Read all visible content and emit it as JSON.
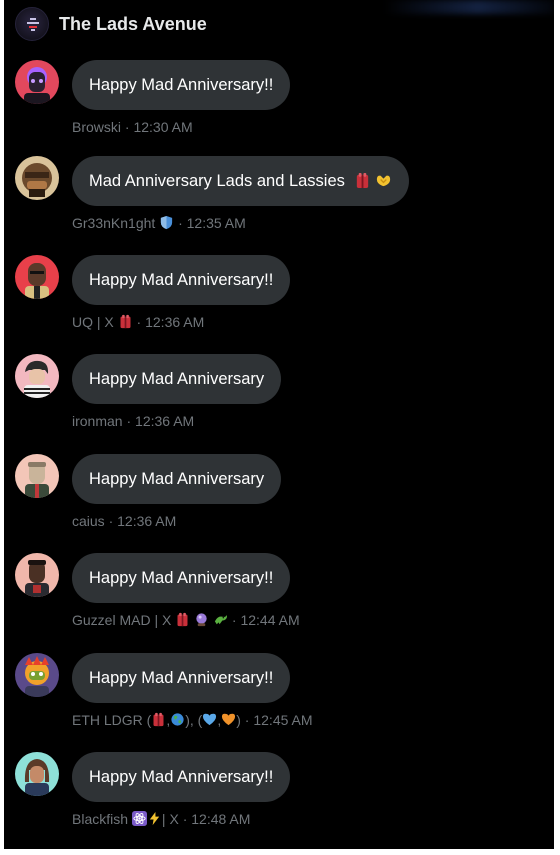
{
  "header": {
    "title": "The Lads Avenue",
    "avatar_icon": "lads-avenue-logo-icon"
  },
  "colors": {
    "bubble": "#2f3336",
    "meta_text": "#71767b",
    "background": "#000000",
    "title_text": "#e7e9ea"
  },
  "messages": [
    {
      "text": "Happy Mad Anniversary!!",
      "sender": "Browski",
      "time": "12:30 AM"
    },
    {
      "text": "Mad Anniversary Lads and Lassies",
      "sender": "Gr33nKn1ght",
      "time": "12:35 AM"
    },
    {
      "text": "Happy Mad Anniversary!!",
      "sender": "UQ | X",
      "time": "12:36 AM"
    },
    {
      "text": "Happy Mad Anniversary",
      "sender": "ironman",
      "time": "12:36 AM"
    },
    {
      "text": "Happy Mad Anniversary",
      "sender": "caius",
      "time": "12:36 AM"
    },
    {
      "text": "Happy Mad Anniversary!!",
      "sender": "Guzzel MAD | X",
      "time": "12:44 AM"
    },
    {
      "text": "Happy Mad Anniversary!!",
      "sender": "ETH LDGR (",
      "sender_mid1": ",",
      "sender_mid2": "), (",
      "sender_mid3": ",",
      "sender_end": ")",
      "time": "12:45 AM"
    },
    {
      "text": "Happy Mad Anniversary!!",
      "sender": "Blackfish",
      "sender_end": "| X",
      "time": "12:48 AM"
    }
  ],
  "separator": "·"
}
